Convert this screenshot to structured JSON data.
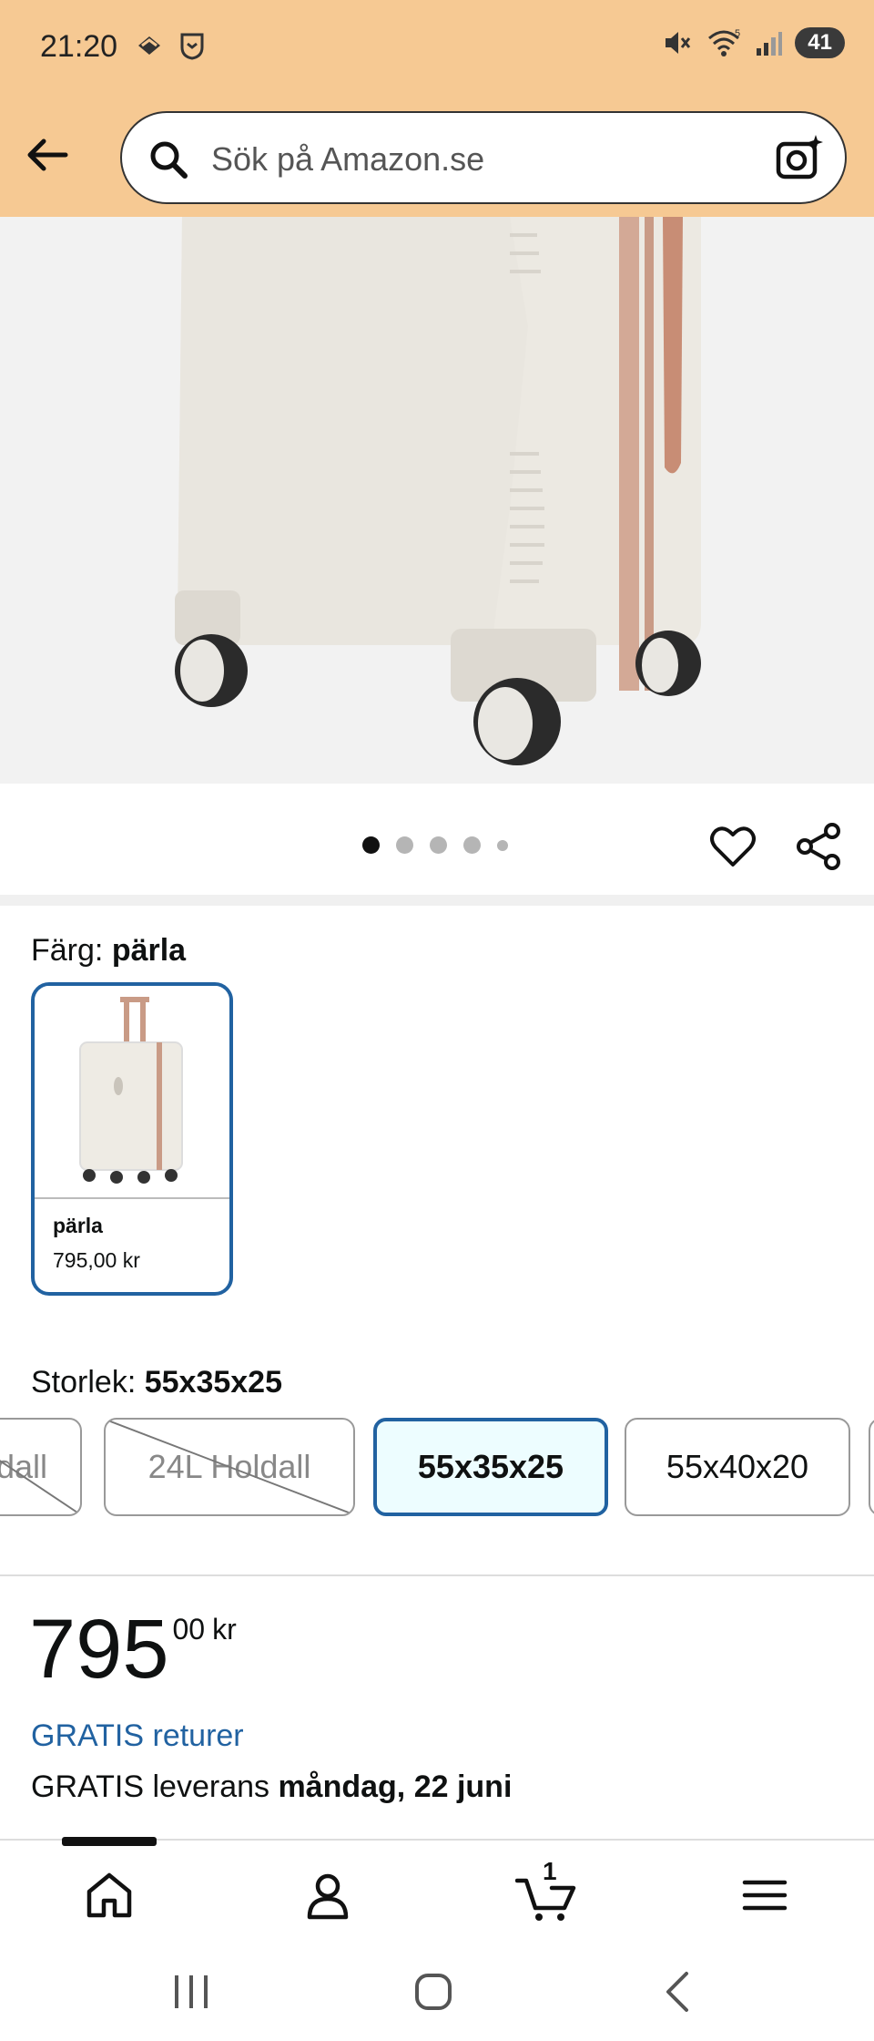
{
  "status_bar": {
    "time": "21:20",
    "wifi_badge": "5",
    "battery": "41"
  },
  "search": {
    "placeholder": "Sök på Amazon.se"
  },
  "gallery": {
    "image_count": 5,
    "active_index": 0
  },
  "color": {
    "label": "Färg: ",
    "value": "pärla",
    "swatch": {
      "name": "pärla",
      "price": "795,00 kr"
    }
  },
  "size": {
    "label": "Storlek: ",
    "value": "55x35x25",
    "options": [
      {
        "label": "dall",
        "state": "disabled"
      },
      {
        "label": "24L Holdall",
        "state": "disabled"
      },
      {
        "label": "55x35x25",
        "state": "selected"
      },
      {
        "label": "55x40x20",
        "state": "available"
      }
    ]
  },
  "price": {
    "whole": "795",
    "fraction": "00",
    "currency": "kr"
  },
  "shipping": {
    "free_returns": "GRATIS returer",
    "delivery_prefix": "GRATIS leverans ",
    "delivery_date": "måndag, 22 juni"
  },
  "bottom_nav": {
    "cart_count": "1"
  },
  "colors": {
    "header": "#f6c993",
    "selected_border": "#2162a1",
    "link": "#2162a1"
  }
}
